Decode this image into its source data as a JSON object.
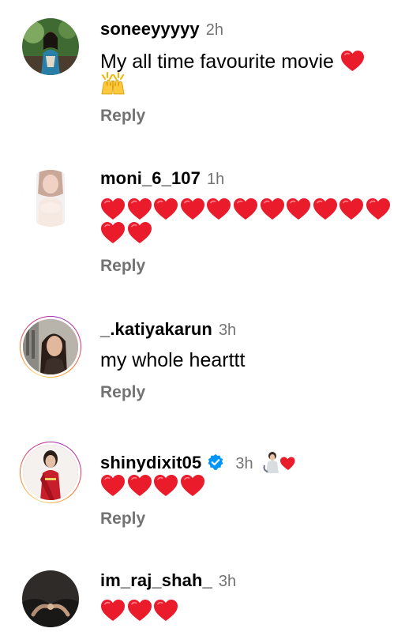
{
  "comments": [
    {
      "username": "soneeyyyyy",
      "time": "2h",
      "text": "My all time favourite movie",
      "reply_label": "Reply",
      "has_story_ring": false
    },
    {
      "username": "moni_6_107",
      "time": "1h",
      "emoji": "heart",
      "emoji_count": 13,
      "reply_label": "Reply",
      "has_story_ring": false
    },
    {
      "username": "_.katiyakarun",
      "time": "3h",
      "text": "my whole hearttt",
      "reply_label": "Reply",
      "has_story_ring": true
    },
    {
      "username": "shinydixit05",
      "verified": true,
      "time": "3h",
      "emoji": "heart",
      "emoji_count": 4,
      "reply_label": "Reply",
      "has_story_ring": true
    },
    {
      "username": "im_raj_shah_",
      "time": "3h",
      "emoji": "heart",
      "emoji_count": 3,
      "has_story_ring": false
    }
  ],
  "colors": {
    "heart": "#ea1c2c",
    "verified": "#0095f6",
    "secondary_text": "#737373"
  },
  "icons": [
    "red-heart-emoji",
    "raising-hands-emoji",
    "verified-badge-icon",
    "sticker-icon"
  ]
}
